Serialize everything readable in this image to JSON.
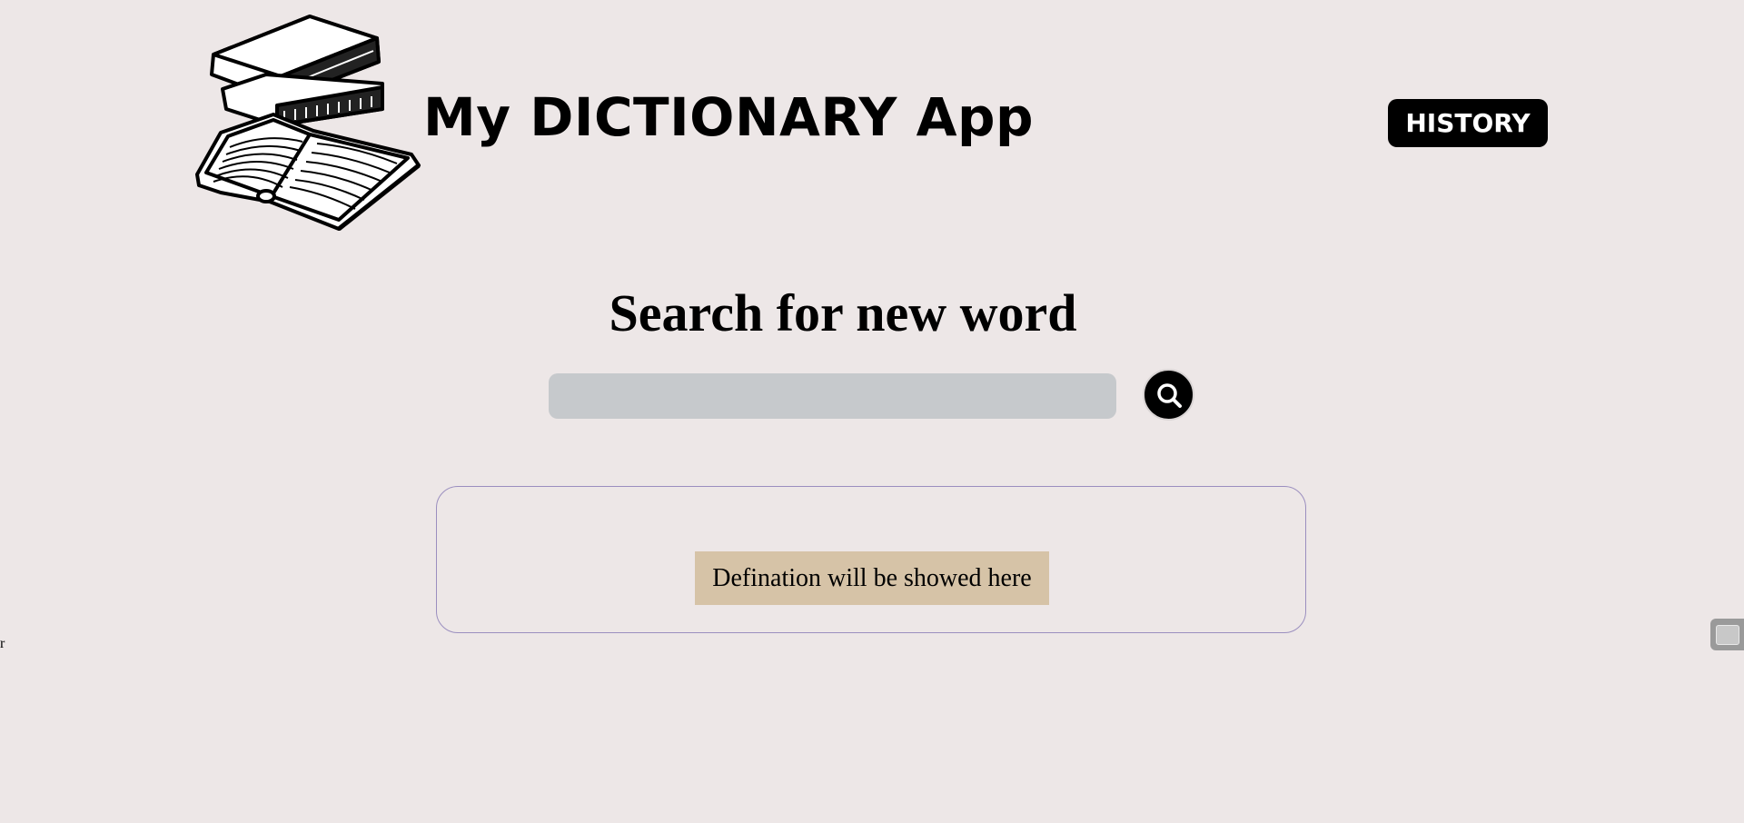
{
  "header": {
    "app_title": "My DICTIONARY App",
    "history_label": "HISTORY",
    "logo_icon": "books-icon"
  },
  "search": {
    "heading": "Search for new word",
    "input_value": "",
    "placeholder": "",
    "button_icon": "search-icon"
  },
  "definition": {
    "placeholder_text": "Defination will be showed here"
  },
  "edge_text": "r",
  "floating_widget_icon": "chat-widget-icon",
  "colors": {
    "background": "#ede7e7",
    "history_button": "#000000",
    "search_input_bg": "#c6c9cc",
    "definition_border": "#9b8fbf",
    "definition_text_bg": "#d6c3a7"
  }
}
